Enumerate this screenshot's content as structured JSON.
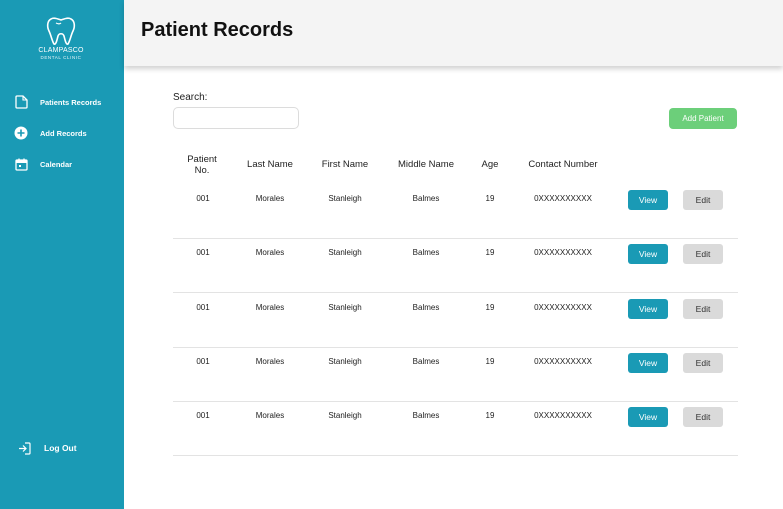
{
  "sidebar": {
    "brand": "CLAMPASCO",
    "brand_sub": "DENTAL CLINIC",
    "items": [
      {
        "label": "Patients Records",
        "icon": "file-icon"
      },
      {
        "label": "Add Records",
        "icon": "plus-circle-icon"
      },
      {
        "label": "Calendar",
        "icon": "calendar-icon"
      }
    ],
    "logout_label": "Log Out"
  },
  "header": {
    "title": "Patient Records"
  },
  "search": {
    "label": "Search:",
    "value": "",
    "placeholder": ""
  },
  "add_button_label": "Add Patient",
  "table": {
    "headers": [
      "Patient No.",
      "Last Name",
      "First Name",
      "Middle Name",
      "Age",
      "Contact Number"
    ],
    "rows": [
      {
        "no": "001",
        "last": "Morales",
        "first": "Stanleigh",
        "middle": "Balmes",
        "age": "19",
        "contact": "0XXXXXXXXXX"
      },
      {
        "no": "001",
        "last": "Morales",
        "first": "Stanleigh",
        "middle": "Balmes",
        "age": "19",
        "contact": "0XXXXXXXXXX"
      },
      {
        "no": "001",
        "last": "Morales",
        "first": "Stanleigh",
        "middle": "Balmes",
        "age": "19",
        "contact": "0XXXXXXXXXX"
      },
      {
        "no": "001",
        "last": "Morales",
        "first": "Stanleigh",
        "middle": "Balmes",
        "age": "19",
        "contact": "0XXXXXXXXXX"
      },
      {
        "no": "001",
        "last": "Morales",
        "first": "Stanleigh",
        "middle": "Balmes",
        "age": "19",
        "contact": "0XXXXXXXXXX"
      }
    ],
    "view_label": "View",
    "edit_label": "Edit"
  },
  "colors": {
    "primary": "#1a9ab5",
    "add": "#6ccf7a",
    "edit": "#dadada",
    "topbar": "#f4f4f4"
  }
}
